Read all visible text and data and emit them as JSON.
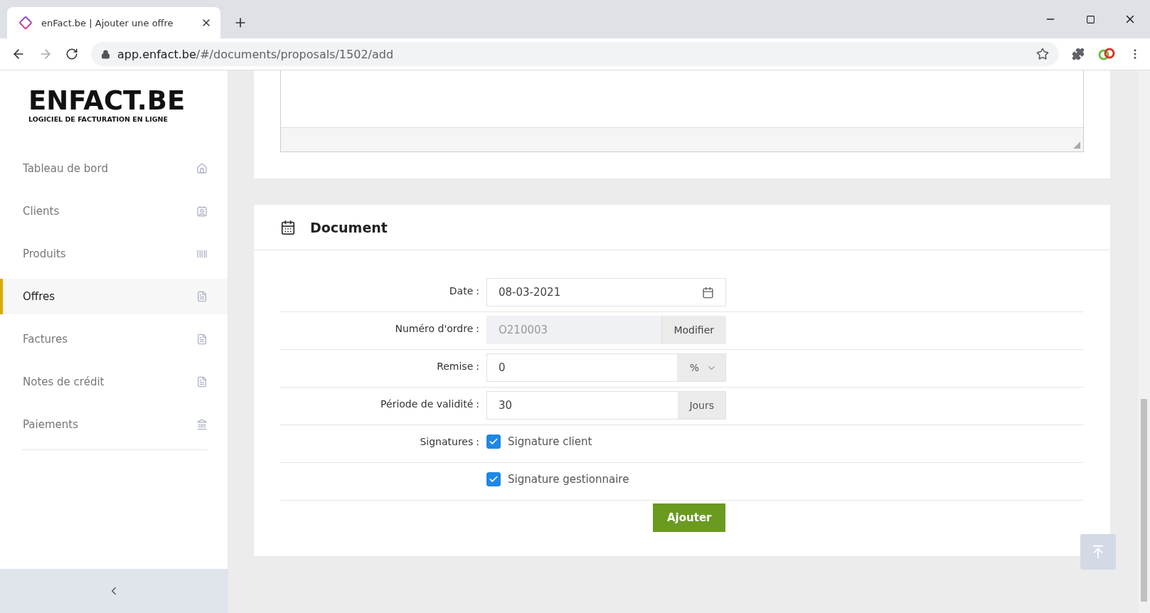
{
  "browser": {
    "tab_title": "enFact.be | Ajouter une offre",
    "url_host": "app.enfact.be",
    "url_path": "/#/documents/proposals/1502/add"
  },
  "sidebar": {
    "logo_title": "ENFACT.BE",
    "logo_subtitle": "LOGICIEL DE FACTURATION EN LIGNE",
    "items": [
      {
        "label": "Tableau de bord",
        "selected": false
      },
      {
        "label": "Clients",
        "selected": false
      },
      {
        "label": "Produits",
        "selected": false
      },
      {
        "label": "Offres",
        "selected": true
      },
      {
        "label": "Factures",
        "selected": false
      },
      {
        "label": "Notes de crédit",
        "selected": false
      },
      {
        "label": "Paiements",
        "selected": false
      }
    ]
  },
  "document": {
    "title": "Document",
    "rows": [
      {
        "kind": "date",
        "label": "Date",
        "separator": ":",
        "value": "08-03-2021"
      },
      {
        "kind": "button_addon",
        "label": "Numéro d'ordre",
        "separator": ":",
        "value": "O210003",
        "disabled": true,
        "addon": "Modifier"
      },
      {
        "kind": "select_addon",
        "label": "Remise",
        "separator": ":",
        "value": "0",
        "addon": "%"
      },
      {
        "kind": "text_addon",
        "label": "Période de validité",
        "separator": ":",
        "value": "30",
        "addon": "Jours"
      },
      {
        "kind": "checkbox",
        "label": "Signatures",
        "separator": ":",
        "text": "Signature client",
        "checked": true
      },
      {
        "kind": "checkbox",
        "text": "Signature gestionnaire",
        "checked": true
      }
    ],
    "submit": "Ajouter"
  }
}
